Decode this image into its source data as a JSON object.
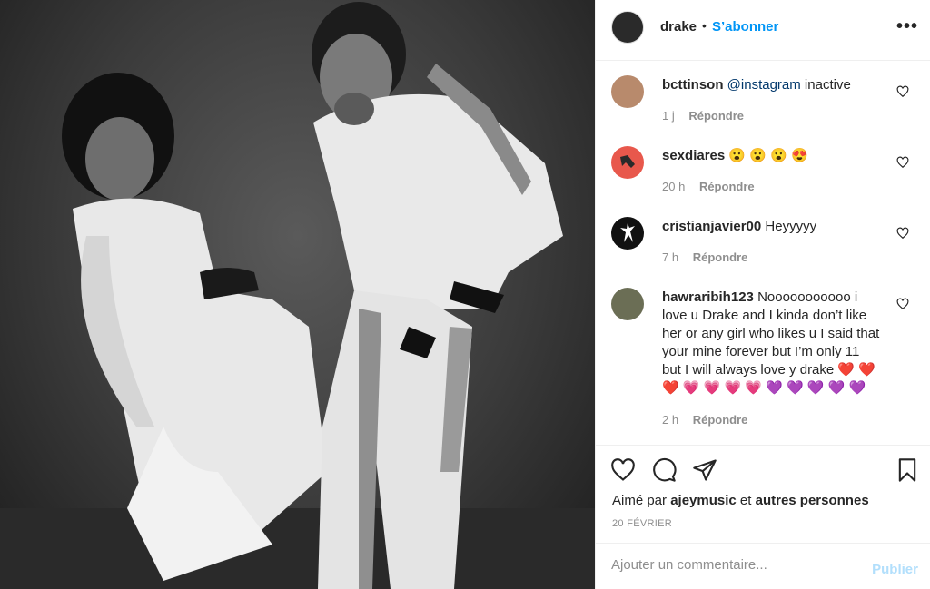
{
  "post": {
    "author": "drake",
    "separator": "•",
    "follow_label": "S’abonner",
    "more_label": "•••",
    "photo_alt": "photo"
  },
  "comments": [
    {
      "username": "bcttinson",
      "mention": "@instagram",
      "text": " inactive",
      "time": "1 j",
      "reply": "Répondre"
    },
    {
      "username": "sexdiares",
      "text": "😮 😮 😮 😍",
      "time": "20 h",
      "reply": "Répondre"
    },
    {
      "username": "cristianjavier00",
      "text": "Heyyyyy",
      "time": "7 h",
      "reply": "Répondre"
    },
    {
      "username": "hawraribih123",
      "text": "Nooooooooooo i love u Drake and I kinda don’t like her or any girl who likes u I said that your mine forever but I’m only 11 but I will always love y drake ❤️ ❤️ ❤️ 💗 💗 💗 💗 💜 💜 💜 💜 💜",
      "time": "2 h",
      "reply": "Répondre"
    }
  ],
  "actions": {
    "liked_by_prefix": "Aimé par ",
    "liked_by_user": "ajeymusic",
    "liked_by_mid": " et ",
    "liked_by_others": "autres personnes",
    "date": "20 FÉVRIER"
  },
  "add_comment": {
    "placeholder": "Ajouter un commentaire...",
    "publish_label": "Publier"
  },
  "colors": {
    "accent": "#0095f6",
    "publish_disabled": "#b2dffc",
    "muted": "#8e8e8e"
  }
}
